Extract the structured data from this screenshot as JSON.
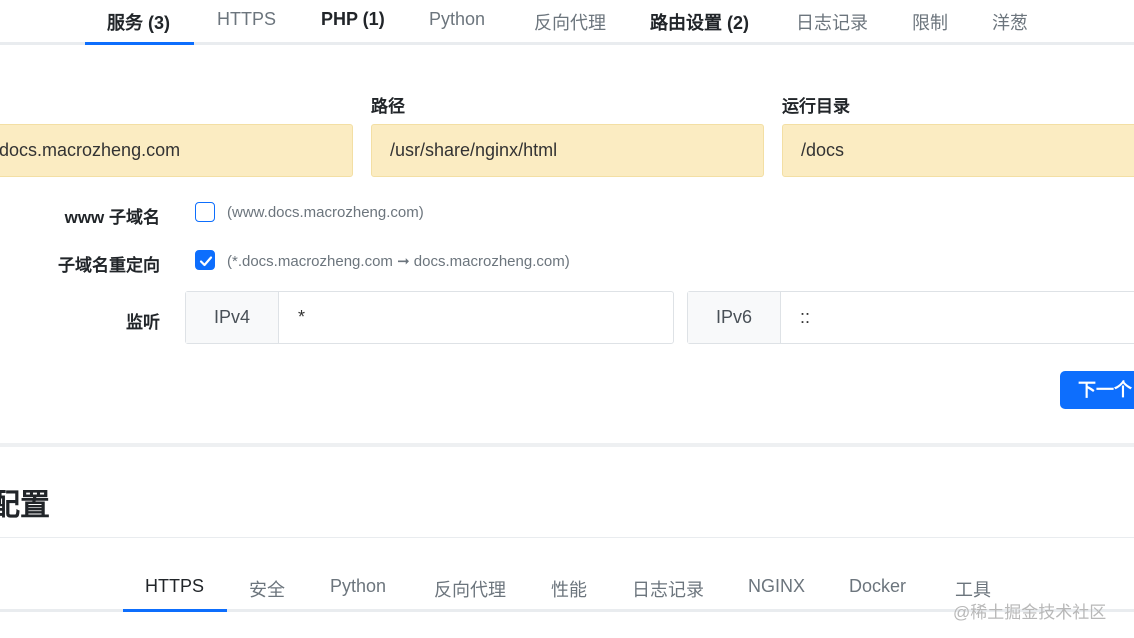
{
  "top_tabs": [
    {
      "label": "服务 (3)"
    },
    {
      "label": "HTTPS"
    },
    {
      "label": "PHP (1)"
    },
    {
      "label": "Python"
    },
    {
      "label": "反向代理"
    },
    {
      "label": "路由设置 (2)"
    },
    {
      "label": "日志记录"
    },
    {
      "label": "限制"
    },
    {
      "label": "洋葱"
    }
  ],
  "fields": {
    "domain_value": "docs.macrozheng.com",
    "path_label": "路径",
    "path_value": "/usr/share/nginx/html",
    "run_dir_label": "运行目录",
    "run_dir_value": "/docs"
  },
  "www_subdomain": {
    "label": "www 子域名",
    "checked": false,
    "hint": "(www.docs.macrozheng.com)"
  },
  "subdomain_redirect": {
    "label": "子域名重定向",
    "checked": true,
    "hint": "(*.docs.macrozheng.com ➞ docs.macrozheng.com)"
  },
  "listen": {
    "label": "监听",
    "ipv4_prefix": "IPv4",
    "ipv4_value": "*",
    "ipv6_prefix": "IPv6",
    "ipv6_value": "::"
  },
  "next_button": "下一个",
  "section_title": "配置",
  "bottom_tabs": [
    {
      "label": "HTTPS"
    },
    {
      "label": "安全"
    },
    {
      "label": "Python"
    },
    {
      "label": "反向代理"
    },
    {
      "label": "性能"
    },
    {
      "label": "日志记录"
    },
    {
      "label": "NGINX"
    },
    {
      "label": "Docker"
    },
    {
      "label": "工具"
    }
  ],
  "watermark": "@稀土掘金技术社区",
  "colors": {
    "accent": "#0d6efd",
    "input_highlight": "#fbecc2"
  }
}
